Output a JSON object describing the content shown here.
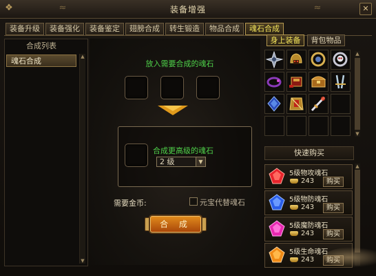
{
  "window": {
    "title": "装备增强"
  },
  "tabs": [
    {
      "label": "装备升级"
    },
    {
      "label": "装备强化"
    },
    {
      "label": "装备鉴定"
    },
    {
      "label": "翅膀合成"
    },
    {
      "label": "转生锻造"
    },
    {
      "label": "物品合成"
    },
    {
      "label": "魂石合成",
      "active": true
    }
  ],
  "left": {
    "header": "合成列表",
    "items": [
      {
        "label": "魂石合成"
      }
    ]
  },
  "center": {
    "put_label": "放入需要合成的魂石",
    "result_label": "合成更高级的魂石",
    "level_select": {
      "value": "2 级"
    },
    "gold_label": "需要金币:",
    "checkbox_label": "元宝代替魂石",
    "combine_button": "合 成"
  },
  "right": {
    "tab_equipped": "身上装备",
    "tab_bag": "背包物品",
    "quick_buy": "快速购买",
    "grid_icons": [
      "cross-shuriken-icon",
      "gold-helmet-icon",
      "amulet-ring-icon",
      "skull-ring-icon",
      "purple-bracelet-icon",
      "red-chest-icon",
      "treasure-box-icon",
      "twin-blade-icon",
      "blue-gem-icon",
      "gold-armor-icon",
      "fire-sword-icon",
      "empty",
      "empty",
      "empty",
      "empty",
      "empty"
    ],
    "shop": [
      {
        "name": "5级物攻魂石",
        "price": "243",
        "buy": "购买",
        "gem_color": "#e8242c",
        "icon": "red-gem-icon"
      },
      {
        "name": "5级物防魂石",
        "price": "243",
        "buy": "购买",
        "gem_color": "#2b5ee8",
        "icon": "blue-gem-icon"
      },
      {
        "name": "5级魔防魂石",
        "price": "243",
        "buy": "购买",
        "gem_color": "#e828b0",
        "icon": "pink-gem-icon"
      },
      {
        "name": "5级生命魂石",
        "price": "243",
        "buy": "购买",
        "gem_color": "#f08a16",
        "icon": "orange-gem-icon"
      }
    ]
  },
  "colors": {
    "accent_green": "#4fd24a",
    "tab_active": "#f2e35a",
    "button_orange": "#e08a1c"
  }
}
